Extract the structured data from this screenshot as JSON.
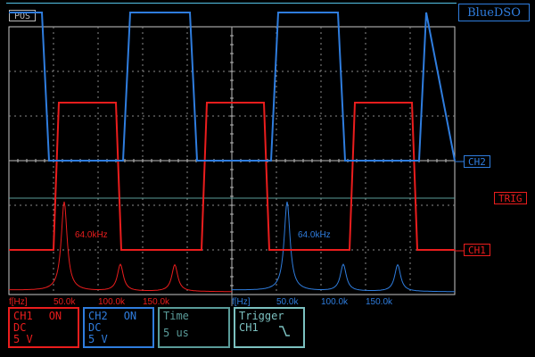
{
  "brand": "BlueDSO",
  "pos_label": "POS",
  "markers": {
    "ch2": "CH2",
    "trig": "TRIG",
    "ch1": "CH1"
  },
  "colors": {
    "ch1": "#ea1d1d",
    "ch2": "#2f7dde",
    "time": "#5a9b99",
    "trigger": "#7cc1c0",
    "grid": "#c8c8c8"
  },
  "fft": {
    "ch1": {
      "peak_label": "64.0kHz",
      "axis_unit": "f[Hz]",
      "ticks": [
        "50.0k",
        "100.0k",
        "150.0k"
      ]
    },
    "ch2": {
      "peak_label": "64.0kHz",
      "axis_unit": "f[Hz]",
      "ticks": [
        "50.0k",
        "100.0k",
        "150.0k"
      ]
    }
  },
  "panels": {
    "ch1": {
      "name": "CH1",
      "state": "ON",
      "coupling": "DC",
      "scale": "5 V"
    },
    "ch2": {
      "name": "CH2",
      "state": "ON",
      "coupling": "DC",
      "scale": "5 V"
    },
    "time": {
      "title": "Time",
      "value": "5 us"
    },
    "trigger": {
      "title": "Trigger",
      "source": "CH1",
      "edge_icon": "rising-edge-icon"
    }
  }
}
